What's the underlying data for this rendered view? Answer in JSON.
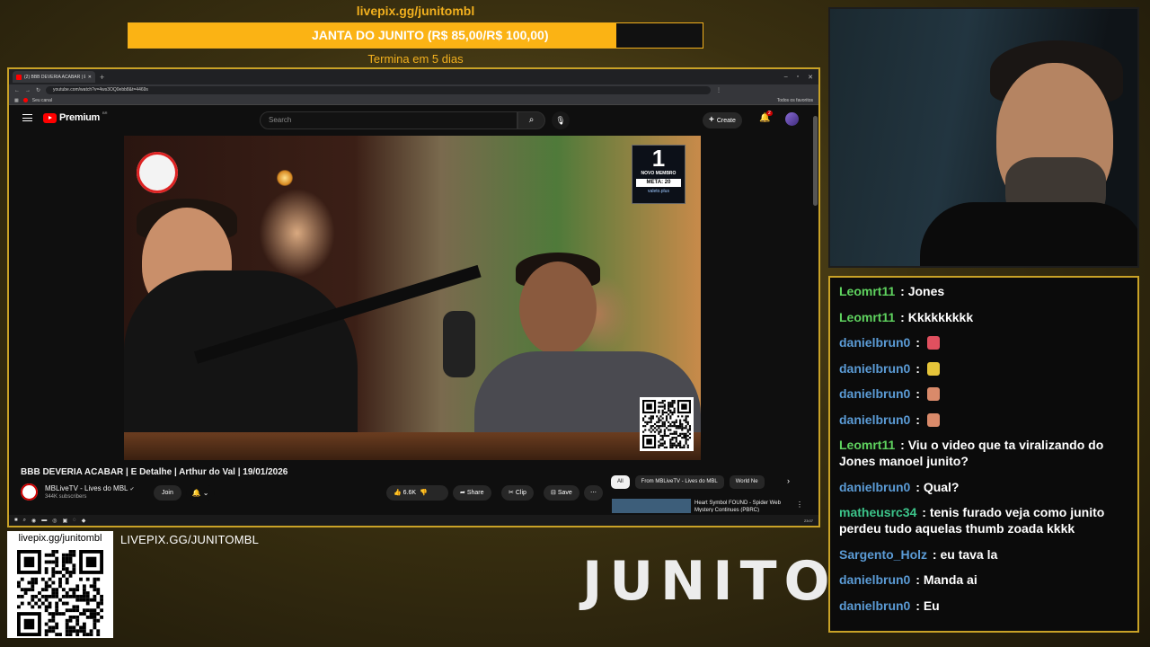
{
  "goal": {
    "url": "livepix.gg/junitombl",
    "text": "JANTA DO JUNITO (R$ 85,00/R$ 100,00)",
    "progress_fraction": 0.85,
    "ends": "Termina em 5 dias",
    "fill_color": "#fbb314"
  },
  "browser": {
    "tab_title": "(2) BBB DEVERIA ACABAR | E...",
    "url": "youtube.com/watch?v=4ws3OQ0ebb8&t=4469s",
    "bookmark": "Seu canal",
    "all_bookmarks": "Todos os favoritos"
  },
  "youtube": {
    "logo": "Premium",
    "logo_sup": "BR",
    "search_placeholder": "Search",
    "create_label": "Create",
    "notifications_count": "2",
    "video": {
      "badge_number": "1",
      "badge_line1": "NOVO MEMBRO",
      "badge_meta": "META: 20",
      "badge_site": "valeto.plus"
    },
    "title": "BBB DEVERIA ACABAR | E Detalhe | Arthur do Val | 19/01/2026",
    "channel": "MBLiveTV - Lives do MBL",
    "subscribers": "344K subscribers",
    "join_label": "Join",
    "likes": "6.6K",
    "share_label": "Share",
    "clip_label": "Clip",
    "save_label": "Save",
    "chips": [
      "All",
      "From MBLiveTV - Lives do MBL",
      "World Ne"
    ],
    "rec_title": "Heart Symbol FOUND - Spider Web Mystery Continues (PBRC)"
  },
  "taskbar": {
    "clock": "23:07"
  },
  "chat": [
    {
      "user": "Leomrt11",
      "color": "#5fd35f",
      "text": "Jones"
    },
    {
      "user": "Leomrt11",
      "color": "#5fd35f",
      "text": "Kkkkkkkkk"
    },
    {
      "user": "danielbrun0",
      "color": "#5b9bd5",
      "text": "",
      "emote": "#e0505f"
    },
    {
      "user": "danielbrun0",
      "color": "#5b9bd5",
      "text": "",
      "emote": "#e6c53a"
    },
    {
      "user": "danielbrun0",
      "color": "#5b9bd5",
      "text": "",
      "emote": "#d98a6a"
    },
    {
      "user": "danielbrun0",
      "color": "#5b9bd5",
      "text": "",
      "emote": "#d98a6a"
    },
    {
      "user": "Leomrt11",
      "color": "#5fd35f",
      "text": "Viu o video que ta viralizando do Jones manoel junito?"
    },
    {
      "user": "danielbrun0",
      "color": "#5b9bd5",
      "text": "Qual?"
    },
    {
      "user": "matheusrc34",
      "color": "#3cc48a",
      "text": "tenis furado veja como junito perdeu tudo aquelas thumb zoada kkkk"
    },
    {
      "user": "Sargento_Holz",
      "color": "#5b9bd5",
      "text": "eu tava la"
    },
    {
      "user": "danielbrun0",
      "color": "#5b9bd5",
      "text": "Manda ai"
    },
    {
      "user": "danielbrun0",
      "color": "#5b9bd5",
      "text": "Eu"
    }
  ],
  "overlay": {
    "qr_url": "livepix.gg/junitombl",
    "livepix_caps": "LIVEPIX.GG/JUNITOMBL",
    "brand": "JUNITO"
  },
  "colors": {
    "accent": "#f2b01e",
    "frame": "#c9a227",
    "yt_red": "#ff0000"
  }
}
